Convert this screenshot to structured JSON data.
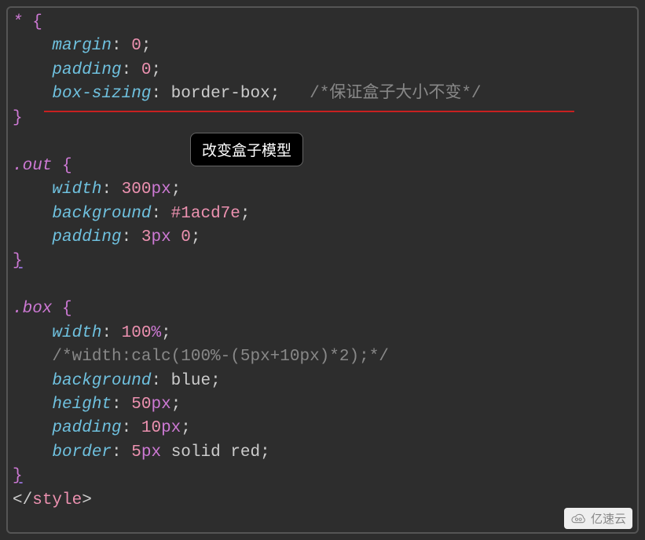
{
  "code": {
    "sel_all": "*",
    "brace_open": "{",
    "brace_close": "}",
    "margin_prop": "margin",
    "zero": "0",
    "padding_prop": "padding",
    "boxsizing_prop": "box-sizing",
    "boxsizing_val": "border-box",
    "comment_boxsizing": "/*保证盒子大小不变*/",
    "sel_out": ".out",
    "width_prop": "width",
    "out_width_num": "300",
    "px_unit": "px",
    "background_prop": "background",
    "out_bg_val": "#1acd7e",
    "out_pad_num": "3",
    "sel_box": ".box",
    "box_width_num": "100",
    "percent_unit": "%",
    "comment_calc": "/*width:calc(100%-(5px+10px)*2);*/",
    "box_bg_val": "blue",
    "height_prop": "height",
    "box_height_num": "50",
    "box_pad_num": "10",
    "border_prop": "border",
    "border_num": "5",
    "border_rest": "solid red",
    "style_close_tag": "style",
    "lt": "<",
    "gt": ">",
    "slash": "/",
    "colon": ":",
    "semi": ";",
    "space": " "
  },
  "callout": "改变盒子模型",
  "watermark": "亿速云"
}
